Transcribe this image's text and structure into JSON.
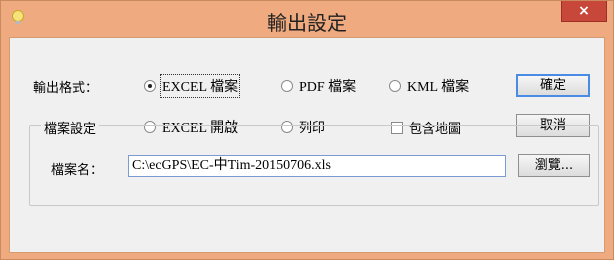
{
  "window": {
    "title": "輸出設定",
    "close_glyph": "×"
  },
  "format": {
    "label": "輸出格式：",
    "options": [
      {
        "label": "EXCEL 檔案",
        "selected": true
      },
      {
        "label": "PDF 檔案",
        "selected": false
      },
      {
        "label": "KML 檔案",
        "selected": false
      },
      {
        "label": "EXCEL 開啟",
        "selected": false
      },
      {
        "label": "列印",
        "selected": false
      }
    ],
    "include_map_label": "包含地圖",
    "include_map_checked": false
  },
  "buttons": {
    "ok": "確定",
    "cancel": "取消",
    "browse": "瀏覽..."
  },
  "file_settings": {
    "group_title": "檔案設定",
    "filename_label": "檔案名：",
    "filename_value": "C:\\ecGPS\\EC-中Tim-20150706.xls"
  },
  "colors": {
    "frame": "#efab7f",
    "close": "#c7483b",
    "default_button_border": "#4a8be6"
  },
  "icons": {
    "app": "lightbulb-icon",
    "close": "close-icon"
  }
}
